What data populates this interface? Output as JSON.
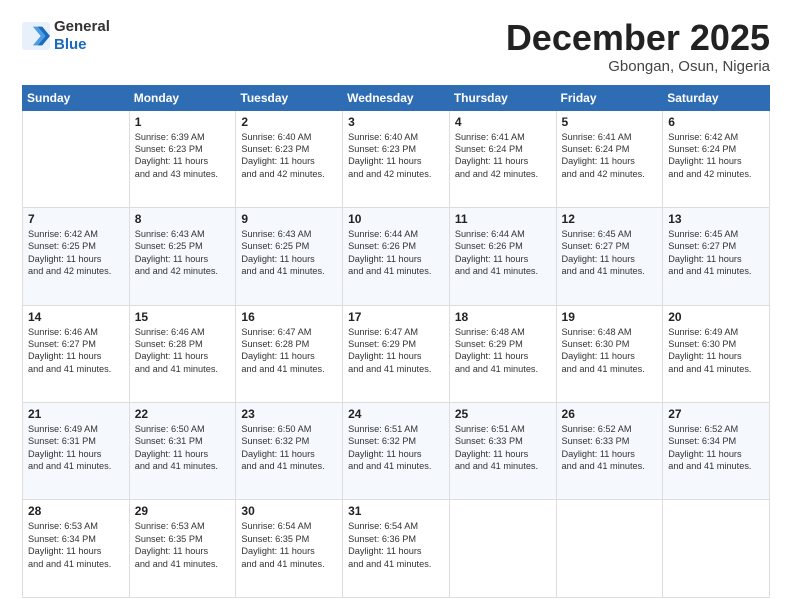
{
  "logo": {
    "general": "General",
    "blue": "Blue"
  },
  "header": {
    "month": "December 2025",
    "location": "Gbongan, Osun, Nigeria"
  },
  "weekdays": [
    "Sunday",
    "Monday",
    "Tuesday",
    "Wednesday",
    "Thursday",
    "Friday",
    "Saturday"
  ],
  "weeks": [
    [
      {
        "day": "",
        "sunrise": "",
        "sunset": "",
        "daylight": ""
      },
      {
        "day": "1",
        "sunrise": "Sunrise: 6:39 AM",
        "sunset": "Sunset: 6:23 PM",
        "daylight": "Daylight: 11 hours and 43 minutes."
      },
      {
        "day": "2",
        "sunrise": "Sunrise: 6:40 AM",
        "sunset": "Sunset: 6:23 PM",
        "daylight": "Daylight: 11 hours and 42 minutes."
      },
      {
        "day": "3",
        "sunrise": "Sunrise: 6:40 AM",
        "sunset": "Sunset: 6:23 PM",
        "daylight": "Daylight: 11 hours and 42 minutes."
      },
      {
        "day": "4",
        "sunrise": "Sunrise: 6:41 AM",
        "sunset": "Sunset: 6:24 PM",
        "daylight": "Daylight: 11 hours and 42 minutes."
      },
      {
        "day": "5",
        "sunrise": "Sunrise: 6:41 AM",
        "sunset": "Sunset: 6:24 PM",
        "daylight": "Daylight: 11 hours and 42 minutes."
      },
      {
        "day": "6",
        "sunrise": "Sunrise: 6:42 AM",
        "sunset": "Sunset: 6:24 PM",
        "daylight": "Daylight: 11 hours and 42 minutes."
      }
    ],
    [
      {
        "day": "7",
        "sunrise": "Sunrise: 6:42 AM",
        "sunset": "Sunset: 6:25 PM",
        "daylight": "Daylight: 11 hours and 42 minutes."
      },
      {
        "day": "8",
        "sunrise": "Sunrise: 6:43 AM",
        "sunset": "Sunset: 6:25 PM",
        "daylight": "Daylight: 11 hours and 42 minutes."
      },
      {
        "day": "9",
        "sunrise": "Sunrise: 6:43 AM",
        "sunset": "Sunset: 6:25 PM",
        "daylight": "Daylight: 11 hours and 41 minutes."
      },
      {
        "day": "10",
        "sunrise": "Sunrise: 6:44 AM",
        "sunset": "Sunset: 6:26 PM",
        "daylight": "Daylight: 11 hours and 41 minutes."
      },
      {
        "day": "11",
        "sunrise": "Sunrise: 6:44 AM",
        "sunset": "Sunset: 6:26 PM",
        "daylight": "Daylight: 11 hours and 41 minutes."
      },
      {
        "day": "12",
        "sunrise": "Sunrise: 6:45 AM",
        "sunset": "Sunset: 6:27 PM",
        "daylight": "Daylight: 11 hours and 41 minutes."
      },
      {
        "day": "13",
        "sunrise": "Sunrise: 6:45 AM",
        "sunset": "Sunset: 6:27 PM",
        "daylight": "Daylight: 11 hours and 41 minutes."
      }
    ],
    [
      {
        "day": "14",
        "sunrise": "Sunrise: 6:46 AM",
        "sunset": "Sunset: 6:27 PM",
        "daylight": "Daylight: 11 hours and 41 minutes."
      },
      {
        "day": "15",
        "sunrise": "Sunrise: 6:46 AM",
        "sunset": "Sunset: 6:28 PM",
        "daylight": "Daylight: 11 hours and 41 minutes."
      },
      {
        "day": "16",
        "sunrise": "Sunrise: 6:47 AM",
        "sunset": "Sunset: 6:28 PM",
        "daylight": "Daylight: 11 hours and 41 minutes."
      },
      {
        "day": "17",
        "sunrise": "Sunrise: 6:47 AM",
        "sunset": "Sunset: 6:29 PM",
        "daylight": "Daylight: 11 hours and 41 minutes."
      },
      {
        "day": "18",
        "sunrise": "Sunrise: 6:48 AM",
        "sunset": "Sunset: 6:29 PM",
        "daylight": "Daylight: 11 hours and 41 minutes."
      },
      {
        "day": "19",
        "sunrise": "Sunrise: 6:48 AM",
        "sunset": "Sunset: 6:30 PM",
        "daylight": "Daylight: 11 hours and 41 minutes."
      },
      {
        "day": "20",
        "sunrise": "Sunrise: 6:49 AM",
        "sunset": "Sunset: 6:30 PM",
        "daylight": "Daylight: 11 hours and 41 minutes."
      }
    ],
    [
      {
        "day": "21",
        "sunrise": "Sunrise: 6:49 AM",
        "sunset": "Sunset: 6:31 PM",
        "daylight": "Daylight: 11 hours and 41 minutes."
      },
      {
        "day": "22",
        "sunrise": "Sunrise: 6:50 AM",
        "sunset": "Sunset: 6:31 PM",
        "daylight": "Daylight: 11 hours and 41 minutes."
      },
      {
        "day": "23",
        "sunrise": "Sunrise: 6:50 AM",
        "sunset": "Sunset: 6:32 PM",
        "daylight": "Daylight: 11 hours and 41 minutes."
      },
      {
        "day": "24",
        "sunrise": "Sunrise: 6:51 AM",
        "sunset": "Sunset: 6:32 PM",
        "daylight": "Daylight: 11 hours and 41 minutes."
      },
      {
        "day": "25",
        "sunrise": "Sunrise: 6:51 AM",
        "sunset": "Sunset: 6:33 PM",
        "daylight": "Daylight: 11 hours and 41 minutes."
      },
      {
        "day": "26",
        "sunrise": "Sunrise: 6:52 AM",
        "sunset": "Sunset: 6:33 PM",
        "daylight": "Daylight: 11 hours and 41 minutes."
      },
      {
        "day": "27",
        "sunrise": "Sunrise: 6:52 AM",
        "sunset": "Sunset: 6:34 PM",
        "daylight": "Daylight: 11 hours and 41 minutes."
      }
    ],
    [
      {
        "day": "28",
        "sunrise": "Sunrise: 6:53 AM",
        "sunset": "Sunset: 6:34 PM",
        "daylight": "Daylight: 11 hours and 41 minutes."
      },
      {
        "day": "29",
        "sunrise": "Sunrise: 6:53 AM",
        "sunset": "Sunset: 6:35 PM",
        "daylight": "Daylight: 11 hours and 41 minutes."
      },
      {
        "day": "30",
        "sunrise": "Sunrise: 6:54 AM",
        "sunset": "Sunset: 6:35 PM",
        "daylight": "Daylight: 11 hours and 41 minutes."
      },
      {
        "day": "31",
        "sunrise": "Sunrise: 6:54 AM",
        "sunset": "Sunset: 6:36 PM",
        "daylight": "Daylight: 11 hours and 41 minutes."
      },
      {
        "day": "",
        "sunrise": "",
        "sunset": "",
        "daylight": ""
      },
      {
        "day": "",
        "sunrise": "",
        "sunset": "",
        "daylight": ""
      },
      {
        "day": "",
        "sunrise": "",
        "sunset": "",
        "daylight": ""
      }
    ]
  ]
}
